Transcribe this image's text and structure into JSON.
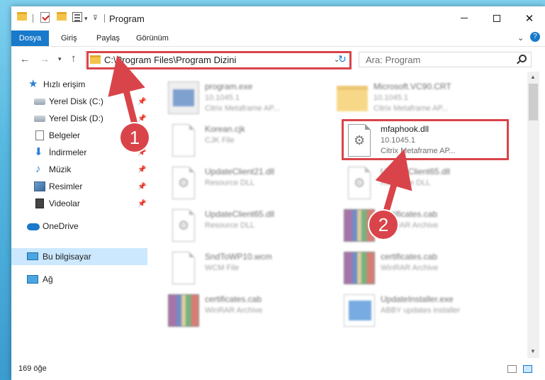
{
  "window": {
    "title": "Program",
    "qa_down_glyph": "▾",
    "qa_customize_glyph": "⊽",
    "min_icon": "minimize-icon",
    "max_icon": "maximize-icon",
    "close_glyph": "✕"
  },
  "ribbon": {
    "tabs": [
      "Dosya",
      "Giriş",
      "Paylaş",
      "Görünüm"
    ],
    "expand_glyph": "⌄",
    "help_glyph": "?"
  },
  "nav": {
    "back_glyph": "←",
    "forward_glyph": "→",
    "recent_glyph": "▾",
    "up_glyph": "↑",
    "address": "C:\\Program Files\\Program Dizini",
    "address_dropdown_glyph": "⌄",
    "refresh_glyph": "↻",
    "search_placeholder": "Ara: Program"
  },
  "sidebar": {
    "items": [
      {
        "label": "Hızlı erişim",
        "icon": "star-icon",
        "glyph": "★",
        "pinned": false
      },
      {
        "label": "Yerel Disk (C:)",
        "icon": "drive-icon",
        "pinned": true
      },
      {
        "label": "Yerel Disk (D:)",
        "icon": "drive-icon",
        "pinned": true
      },
      {
        "label": "Belgeler",
        "icon": "documents-icon",
        "pinned": true
      },
      {
        "label": "İndirmeler",
        "icon": "download-icon",
        "glyph": "⬇",
        "pinned": true
      },
      {
        "label": "Müzik",
        "icon": "music-icon",
        "glyph": "♪",
        "pinned": true
      },
      {
        "label": "Resimler",
        "icon": "pictures-icon",
        "pinned": true
      },
      {
        "label": "Videolar",
        "icon": "videos-icon",
        "pinned": true
      },
      {
        "label": "OneDrive",
        "icon": "cloud-icon"
      },
      {
        "label": "Bu bilgisayar",
        "icon": "computer-icon",
        "selected": true
      },
      {
        "label": "Ağ",
        "icon": "network-icon"
      }
    ],
    "pin_glyph": "📌"
  },
  "files": [
    {
      "name": "program.exe",
      "line2": "10.1045.1",
      "line3": "Citrix Metaframe AP...",
      "icon": "exe-icon",
      "blurred": true
    },
    {
      "name": "Microsoft.VC90.CRT",
      "line2": "10.1045.1",
      "line3": "Citrix Metaframe AP...",
      "icon": "folder-icon",
      "blurred": true
    },
    {
      "name": "Korean.cjk",
      "line2": "CJK File",
      "line3": "",
      "icon": "document-icon",
      "blurred": true
    },
    {
      "name": "mfaphook.dll",
      "line2": "10.1045.1",
      "line3": "Citrix Metaframe AP...",
      "icon": "dll-gear-icon",
      "blurred": false
    },
    {
      "name": "UpdateClient21.dll",
      "line2": "Resource DLL",
      "line3": "",
      "icon": "dll-gear-icon",
      "blurred": true
    },
    {
      "name": "UpdateClient65.dll",
      "line2": "Resource DLL",
      "line3": "",
      "icon": "dll-gear-icon",
      "blurred": true
    },
    {
      "name": "UpdateClient65.dll",
      "line2": "Resource DLL",
      "line3": "",
      "icon": "dll-gear-icon",
      "blurred": true
    },
    {
      "name": "certificates.cab",
      "line2": "WinRAR Archive",
      "line3": "",
      "icon": "winrar-icon",
      "blurred": true
    },
    {
      "name": "SndToWP10.wcm",
      "line2": "WCM File",
      "line3": "",
      "icon": "document-icon",
      "blurred": true
    },
    {
      "name": "certificates.cab",
      "line2": "WinRAR Archive",
      "line3": "",
      "icon": "winrar-icon",
      "blurred": true
    },
    {
      "name": "certificates.cab",
      "line2": "WinRAR Archive",
      "line3": "",
      "icon": "winrar-icon",
      "blurred": true
    },
    {
      "name": "UpdateInstaller.exe",
      "line2": "ABBY updates installer",
      "line3": "",
      "icon": "installer-icon",
      "blurred": true
    }
  ],
  "scrollbar": {
    "up_glyph": "▲",
    "down_glyph": "▼"
  },
  "status": {
    "item_count": "169 öğe"
  },
  "annotations": {
    "callout_1": "1",
    "callout_2": "2",
    "color": "#d9444a"
  }
}
